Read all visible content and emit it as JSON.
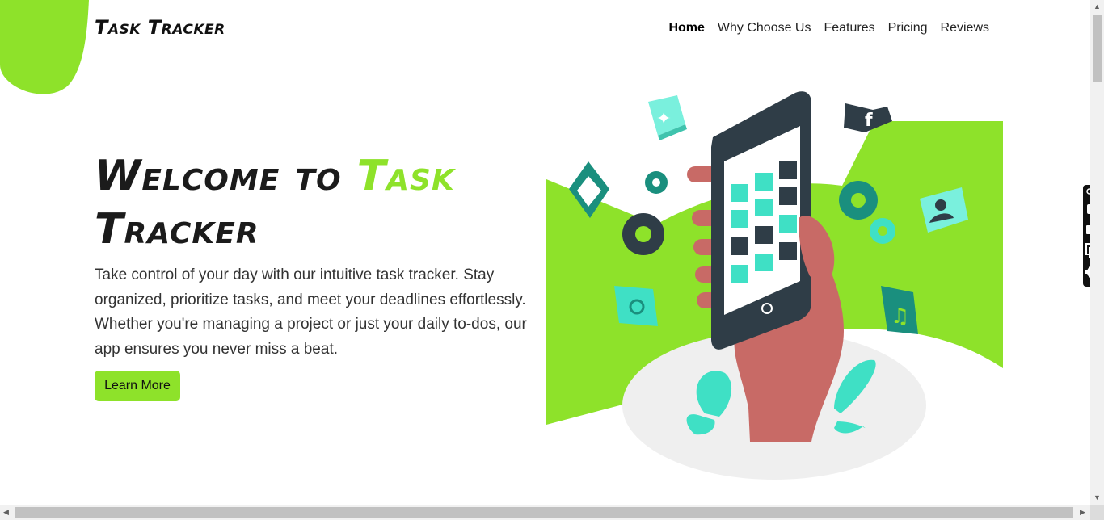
{
  "brand": {
    "name": "Task Tracker",
    "accent_color": "#8ee22a"
  },
  "nav": {
    "items": [
      {
        "label": "Home",
        "active": true
      },
      {
        "label": "Why Choose Us",
        "active": false
      },
      {
        "label": "Features",
        "active": false
      },
      {
        "label": "Pricing",
        "active": false
      },
      {
        "label": "Reviews",
        "active": false
      }
    ]
  },
  "hero": {
    "title_prefix": "Welcome to ",
    "title_accent": "Task",
    "title_suffix": "Tracker",
    "description": "Take control of your day with our intuitive task tracker. Stay organized, prioritize tasks, and meet your deadlines effortlessly. Whether you're managing a project or just your daily to-dos, our app ensures you never miss a beat.",
    "cta_label": "Learn More"
  },
  "illustration": {
    "app_icons": [
      "twitter-icon",
      "facebook-icon",
      "mail-icon",
      "gear-icon",
      "user-icon",
      "music-icon",
      "camera-icon",
      "instagram-icon",
      "image-icon",
      "video-icon"
    ],
    "colors": {
      "green": "#8ee22a",
      "teal": "#3fe0c5",
      "dark": "#2f3d47",
      "skin": "#c86a66"
    }
  },
  "side_toolbar": {
    "icons": [
      "link-icon",
      "camera-icon",
      "video-icon",
      "window-icon",
      "settings-icon"
    ]
  },
  "scrollbar": {
    "up": "▲",
    "down": "▼",
    "left": "◀",
    "right": "▶"
  }
}
